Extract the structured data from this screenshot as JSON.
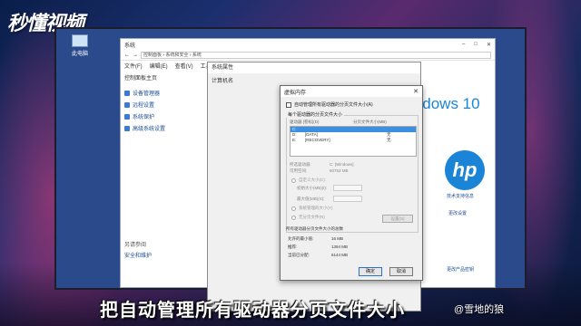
{
  "watermark": "秒懂视频",
  "desktop": {
    "icon_label": "此电脑"
  },
  "system_window": {
    "title": "系统",
    "address": "控制面板 › 系统和安全 › 系统",
    "menu": [
      "文件(F)",
      "编辑(E)",
      "查看(V)",
      "工具(T)"
    ],
    "left_home": "控制面板主页",
    "left_links": [
      "设备管理器",
      "远程设置",
      "系统保护",
      "高级系统设置"
    ],
    "see_also": "另请参阅",
    "security": "安全和维护",
    "brand_text": "Windows 10",
    "hp_logo": "hp",
    "hp_support": "技术支持信息",
    "change_settings": "更改设置",
    "more_info": "更改产品密钥"
  },
  "prop_window": {
    "title": "系统属性",
    "tab": "计算机名"
  },
  "vm_dialog": {
    "title": "虚拟内存",
    "auto_manage": "自动管理所有驱动器的分页文件大小(A)",
    "per_drive": "每个驱动器的分页文件大小",
    "col_drive": "驱动器 [卷标](D)",
    "col_size": "分页文件大小(MB)",
    "drives": [
      {
        "letter": "C:",
        "label": "",
        "size": "",
        "selected": true
      },
      {
        "letter": "D:",
        "label": "[DATA]",
        "size": "无",
        "selected": false
      },
      {
        "letter": "E:",
        "label": "[RECOVERY]",
        "size": "无",
        "selected": false
      }
    ],
    "selected_drive_label": "所选驱动器:",
    "selected_drive_value": "C: [Windows]",
    "space_label": "可用空间:",
    "space_value": "50753 MB",
    "custom_size": "自定义大小(C):",
    "initial": "初始大小(MB)(I):",
    "maximum": "最大值(MB)(X):",
    "system_managed": "系统管理的大小(Y)",
    "no_paging": "无分页文件(N)",
    "set_button": "设置(S)",
    "total_title": "所有驱动器分页文件大小的总数",
    "min_label": "允许的最小值:",
    "min_value": "16 MB",
    "rec_label": "推荐:",
    "rec_value": "1394 MB",
    "cur_label": "当前已分配:",
    "cur_value": "6144 MB",
    "ok": "确定",
    "cancel": "取消"
  },
  "subtitle": "把自动管理所有驱动器分页文件大小",
  "credit": "@雪地的狼"
}
